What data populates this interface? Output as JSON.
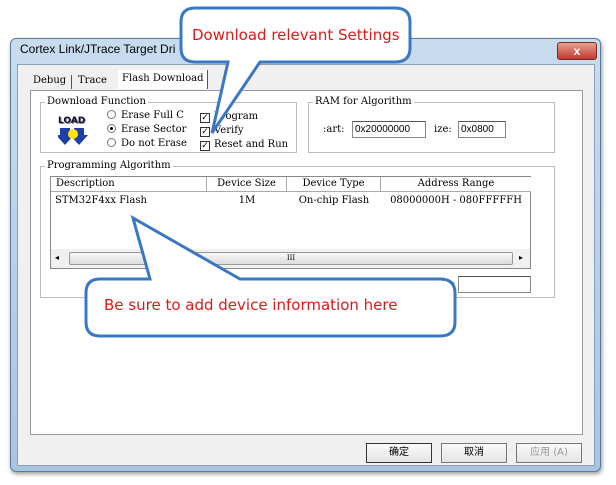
{
  "window": {
    "title": "Cortex  Link/JTrace Target Dri",
    "close_label": "x"
  },
  "tabs": [
    {
      "label": "Debug"
    },
    {
      "label": "Trace"
    },
    {
      "label": "Flash Download"
    }
  ],
  "download_function": {
    "label": "Download Function",
    "icon_text": "LOAD",
    "erase_options": [
      {
        "label": "Erase Full C",
        "selected": false
      },
      {
        "label": "Erase Sector",
        "selected": true
      },
      {
        "label": "Do not Erase",
        "selected": false
      }
    ],
    "checks": [
      {
        "label": "Program",
        "checked": true
      },
      {
        "label": "Verify",
        "checked": true
      },
      {
        "label": "Reset and Run",
        "checked": true
      }
    ]
  },
  "ram": {
    "label": "RAM for Algorithm",
    "start_label": ":art:",
    "start_value": "0x20000000",
    "size_label": "ize:",
    "size_value": "0x0800"
  },
  "algorithm": {
    "label": "Programming Algorithm",
    "columns": [
      "Description",
      "Device Size",
      "Device Type",
      "Address Range"
    ],
    "rows": [
      {
        "description": "STM32F4xx Flash",
        "size": "1M",
        "type": "On-chip Flash",
        "range": "08000000H - 080FFFFFH"
      }
    ],
    "scroll_grip": "III",
    "field_label": ":"
  },
  "buttons": {
    "ok": "确定",
    "cancel": "取消",
    "apply": "应用 (A)"
  },
  "callouts": {
    "top": "Download relevant Settings",
    "bottom": "Be sure to add device information here"
  }
}
